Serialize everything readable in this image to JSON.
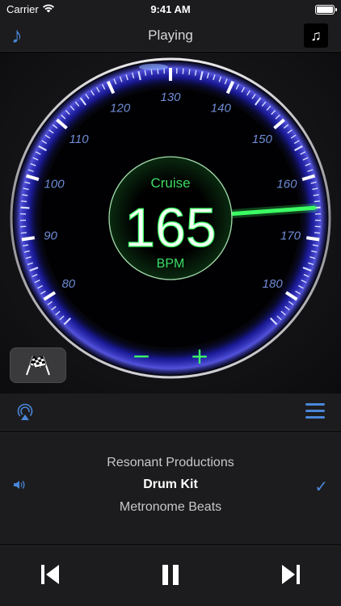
{
  "status": {
    "carrier": "Carrier",
    "time": "9:41 AM"
  },
  "nav": {
    "title": "Playing",
    "left_icon": "music-note-icon",
    "right_icon": "music-notes-icon"
  },
  "gauge": {
    "mode_label": "Cruise",
    "bpm_value": "165",
    "unit_label": "BPM",
    "decrement_label": "−",
    "increment_label": "+",
    "tick_labels": [
      "80",
      "90",
      "100",
      "110",
      "120",
      "130",
      "140",
      "150",
      "160",
      "170",
      "180"
    ],
    "needle_bpm": 165,
    "scale_min": 75,
    "scale_max": 185,
    "accent_color": "#3cff64",
    "ring_color": "#3a3aff"
  },
  "source": {
    "airplay_icon": "airplay-icon",
    "menu_icon": "menu-icon"
  },
  "track": {
    "artist": "Resonant Productions",
    "title": "Drum Kit",
    "album": "Metronome Beats"
  },
  "controls": {
    "prev": "skip-back-icon",
    "pause": "pause-icon",
    "next": "skip-forward-icon"
  }
}
